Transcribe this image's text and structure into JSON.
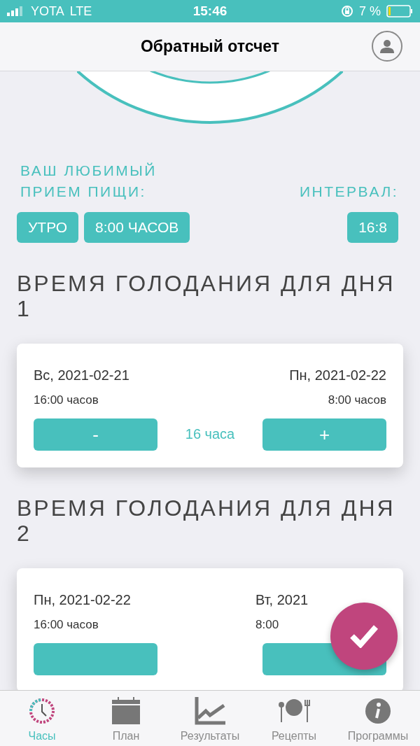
{
  "status_bar": {
    "carrier": "YOTA",
    "network": "LTE",
    "time": "15:46",
    "battery": "7 %"
  },
  "nav_bar": {
    "title": "Обратный отсчет"
  },
  "preferences": {
    "meal_label": "ВАШ ЛЮБИМЫЙ ПРИЕМ ПИЩИ:",
    "meal_tags": [
      "УТРО",
      "8:00 ЧАСОВ"
    ],
    "interval_label": "ИНТЕРВАЛ:",
    "interval_tag": "16:8"
  },
  "days": [
    {
      "heading": "ВРЕМЯ ГОЛОДАНИЯ ДЛЯ ДНЯ 1",
      "start_date": "Вс, 2021-02-21",
      "end_date": "Пн, 2021-02-22",
      "start_time": "16:00 часов",
      "end_time": "8:00 часов",
      "minus": "-",
      "duration": "16 часа",
      "plus": "+"
    },
    {
      "heading": "ВРЕМЯ ГОЛОДАНИЯ ДЛЯ ДНЯ 2",
      "start_date": "Пн, 2021-02-22",
      "end_date": "Вт, 2021",
      "start_time": "16:00 часов",
      "end_time": "8:00"
    }
  ],
  "tab_bar": [
    {
      "label": "Часы",
      "selected": true
    },
    {
      "label": "План",
      "selected": false
    },
    {
      "label": "Результаты",
      "selected": false
    },
    {
      "label": "Рецепты",
      "selected": false
    },
    {
      "label": "Программы",
      "selected": false
    }
  ]
}
